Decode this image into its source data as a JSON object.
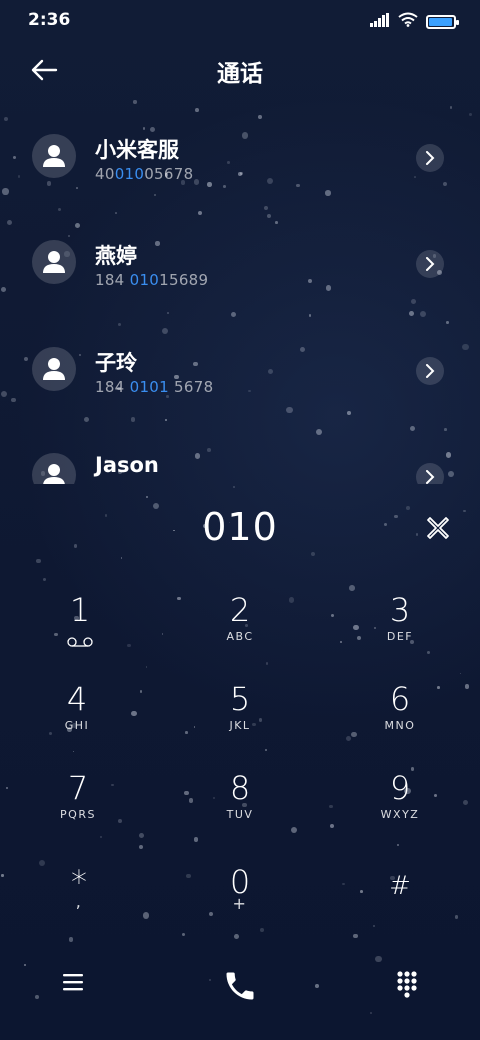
{
  "status": {
    "time": "2:36"
  },
  "header": {
    "title": "通话"
  },
  "contacts": [
    {
      "name": "小米客服",
      "num_pre": "40",
      "num_hl": "010",
      "num_post": "05678"
    },
    {
      "name": "燕婷",
      "num_pre": "184 ",
      "num_hl": "010",
      "num_post": "15689"
    },
    {
      "name": "子玲",
      "num_pre": "184 ",
      "num_hl": "0101",
      "num_post": " 5678"
    },
    {
      "name": "Jason",
      "num_pre": "",
      "num_hl": "",
      "num_post": ""
    }
  ],
  "dial": {
    "input": "010"
  },
  "keys": [
    {
      "digit": "1",
      "letters": ""
    },
    {
      "digit": "2",
      "letters": "ABC"
    },
    {
      "digit": "3",
      "letters": "DEF"
    },
    {
      "digit": "4",
      "letters": "GHI"
    },
    {
      "digit": "5",
      "letters": "JKL"
    },
    {
      "digit": "6",
      "letters": "MNO"
    },
    {
      "digit": "7",
      "letters": "PQRS"
    },
    {
      "digit": "8",
      "letters": "TUV"
    },
    {
      "digit": "9",
      "letters": "WXYZ"
    },
    {
      "digit": "*",
      "letters": ","
    },
    {
      "digit": "0",
      "letters": "+"
    },
    {
      "digit": "#",
      "letters": ""
    }
  ],
  "colors": {
    "accent": "#3a8ef0",
    "background": "#0f1a33"
  },
  "battery_level": 0.95
}
